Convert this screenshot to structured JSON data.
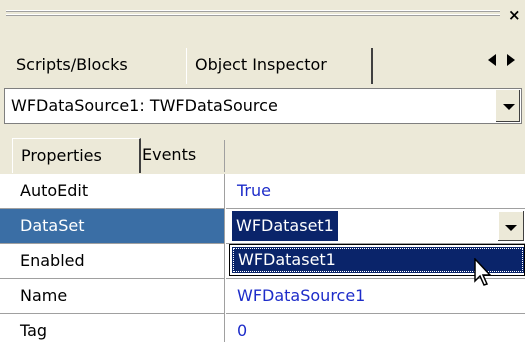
{
  "panel": {
    "close_glyph": "×"
  },
  "tabs": {
    "scripts_label": "Scripts/Blocks",
    "object_inspector_label": "Object Inspector"
  },
  "object_selector": {
    "value": "WFDataSource1: TWFDataSource"
  },
  "subtabs": {
    "properties_label": "Properties",
    "events_label": "Events"
  },
  "properties": [
    {
      "name": "AutoEdit",
      "value": "True"
    },
    {
      "name": "DataSet",
      "value": "WFDataset1"
    },
    {
      "name": "Enabled",
      "value": ""
    },
    {
      "name": "Name",
      "value": "WFDataSource1"
    },
    {
      "name": "Tag",
      "value": "0"
    }
  ],
  "dropdown": {
    "option": "WFDataset1"
  },
  "colors": {
    "selected_row": "#3a6ea5",
    "value_text": "#1d2cc9",
    "highlight": "#0a246a",
    "face": "#ece9d8"
  }
}
